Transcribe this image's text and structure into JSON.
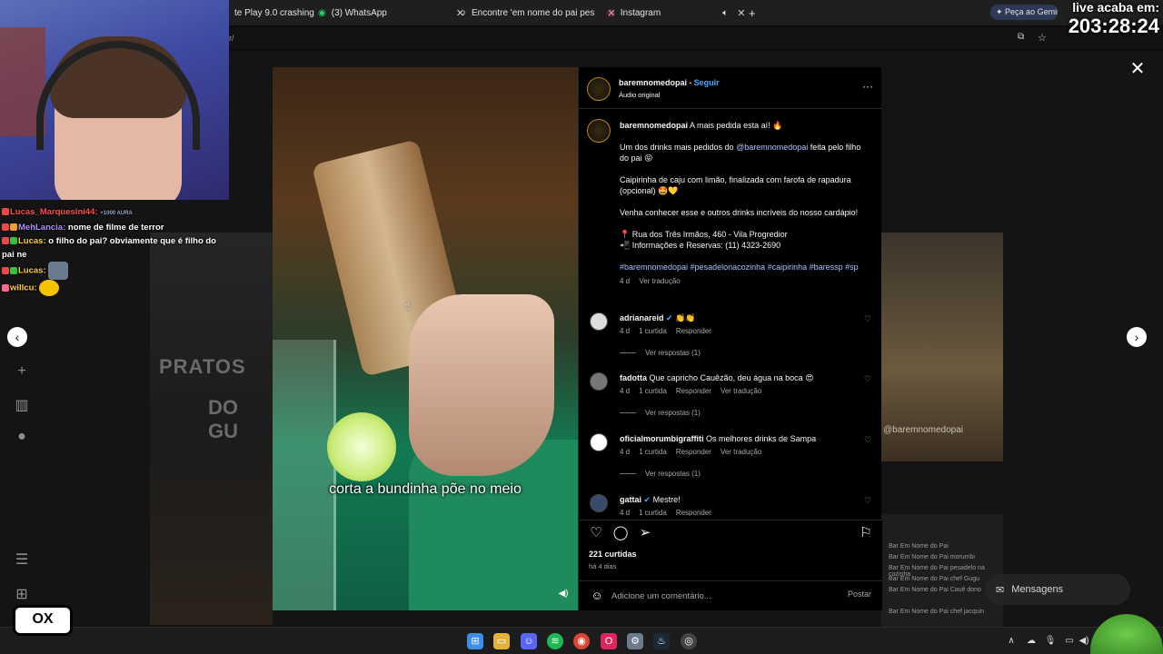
{
  "browser": {
    "tabs": [
      {
        "label": "te Play 9.0 crashing",
        "icon": "play-icon"
      },
      {
        "label": "(3) WhatsApp",
        "icon": "whatsapp-icon"
      },
      {
        "label": "Encontre 'em nome do pai pes",
        "icon": "tiktok-icon"
      },
      {
        "label": "Instagram",
        "icon": "instagram-icon"
      }
    ],
    "address_fragment": "r/",
    "gemini_label": "Peça ao Gemini"
  },
  "live": {
    "line1": "live acaba em:",
    "countdown": "203:28:24"
  },
  "chat": [
    {
      "user": "Lucas_Marquesini44:",
      "text": "",
      "tag": "+1000 AURA"
    },
    {
      "user": "MehLancia:",
      "text": "nome de filme de terror"
    },
    {
      "user": "Lucas:",
      "text": "o filho do pai? obviamente que é filho do pai ne"
    },
    {
      "user": "Lucas:",
      "text": ""
    },
    {
      "user": "willcu:",
      "text": ""
    }
  ],
  "background": {
    "pratos_line1": "PRATOS",
    "pratos_line2": "DO GU",
    "watermark": "@baremnomedopai",
    "mini_lines": [
      "Bar Em Nome do Pai",
      "Bar Em Nome do Pai morumbi",
      "Bar Em Nome do Pai pesadelo na cozinha",
      "Bar Em Nome do Pai chef Gugu",
      "Bar Em Nome do Pai Cauê dono",
      "Bar Em Nome do Pai chef jacquin"
    ],
    "messages_label": "Mensagens"
  },
  "video": {
    "subtitle": "corta a bundinha põe no meio"
  },
  "post": {
    "author": "baremnomedopai",
    "follow_label": "Seguir",
    "audio": "Áudio original",
    "caption_lead": "A mais pedida esta aí! 🔥",
    "caption_p1_a": "Um dos drinks mais pedidos do",
    "caption_p1_mention": "@baremnomedopai",
    "caption_p1_b": "feita pelo filho do pai 😝",
    "caption_p2": "Caipirinha de caju com limão, finalizada com farofa de rapadura (opcional) 🤩💛",
    "caption_p3": "Venha conhecer esse e outros drinks incríveis do nosso cardápio!",
    "caption_addr": "📍 Rua dos Três Irmãos, 460 - Vila Progredior",
    "caption_phone": "📲 Informações e Reservas: (11) 4323-2690",
    "hashtags": "#baremnomedopai #pesadelonacozinha #caipirinha #baressp #sp",
    "caption_age": "4 d",
    "see_translation": "Ver tradução",
    "comments": [
      {
        "user": "adrianareid",
        "verified": true,
        "text": "👏👏",
        "age": "4 d",
        "likes": "1 curtida",
        "reply": "Responder",
        "translate": "",
        "replies": "Ver respostas (1)"
      },
      {
        "user": "fadotta",
        "verified": false,
        "text": "Que capricho Cauêzão, deu água na boca 😍",
        "age": "4 d",
        "likes": "1 curtida",
        "reply": "Responder",
        "translate": "Ver tradução",
        "replies": "Ver respostas (1)"
      },
      {
        "user": "oficialmorumbigraffiti",
        "verified": false,
        "text": "Os melhores drinks de Sampa",
        "age": "4 d",
        "likes": "1 curtida",
        "reply": "Responder",
        "translate": "Ver tradução",
        "replies": "Ver respostas (1)"
      },
      {
        "user": "gattai",
        "verified": true,
        "text": "Mestre!",
        "age": "4 d",
        "likes": "1 curtida",
        "reply": "Responder",
        "translate": "",
        "replies": ""
      }
    ],
    "likes_count": "221 curtidas",
    "posted_ago": "há 4 dias",
    "comment_placeholder": "Adicione um comentário...",
    "post_button": "Postar"
  },
  "overlay_logo": "OX"
}
